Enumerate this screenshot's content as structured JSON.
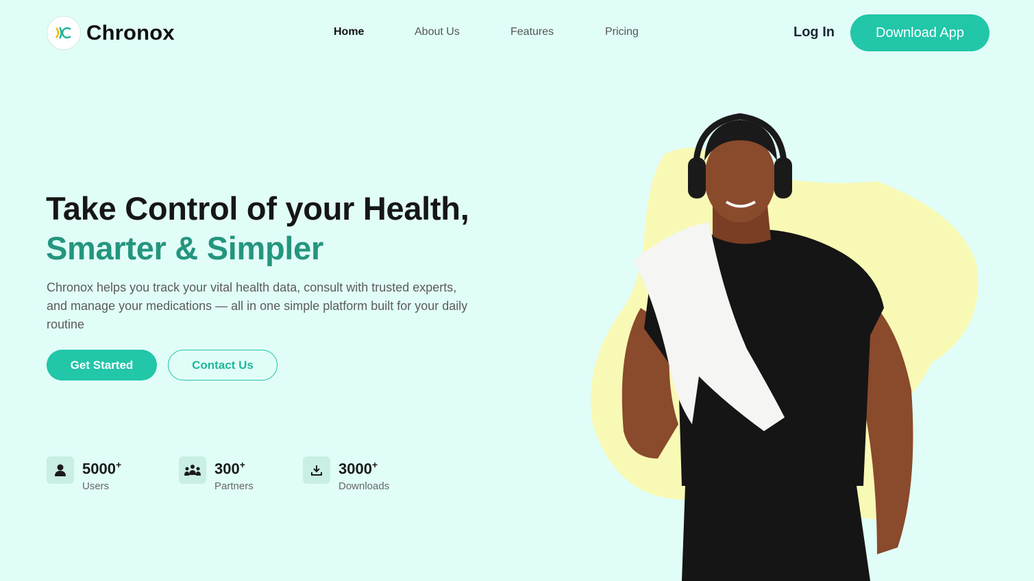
{
  "header": {
    "logo_text": "Chronox",
    "nav": [
      {
        "label": "Home",
        "active": true
      },
      {
        "label": "About Us",
        "active": false
      },
      {
        "label": "Features",
        "active": false
      },
      {
        "label": "Pricing",
        "active": false
      }
    ],
    "login_label": "Log In",
    "download_label": "Download App"
  },
  "hero": {
    "title_line1": "Take Control of your Health,",
    "title_line2": "Smarter & Simpler",
    "description": "Chronox helps you track your vital health data, consult with trusted experts, and manage your medications — all in one simple platform built for your daily routine",
    "primary_cta": "Get Started",
    "secondary_cta": "Contact Us"
  },
  "stats": [
    {
      "value": "5000",
      "suffix": "+",
      "label": "Users",
      "icon": "user-icon"
    },
    {
      "value": "300",
      "suffix": "+",
      "label": "Partners",
      "icon": "partners-icon"
    },
    {
      "value": "3000",
      "suffix": "+",
      "label": "Downloads",
      "icon": "download-icon"
    }
  ],
  "colors": {
    "background": "#e1fdf8",
    "accent": "#22c6a9",
    "accent_dark": "#24957e",
    "blob": "#f8f9b4"
  }
}
